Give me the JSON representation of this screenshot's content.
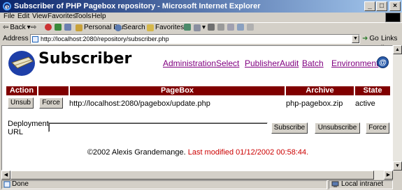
{
  "window": {
    "title": "Subscriber of PHP Pagebox repository - Microsoft Internet Explorer",
    "buttons": {
      "minimize": "_",
      "maximize": "□",
      "close": "×"
    }
  },
  "menu": [
    "File",
    "Edit",
    "View",
    "Favorites",
    "Tools",
    "Help"
  ],
  "toolbar": {
    "back": "Back",
    "personal_bar": "Personal Bar",
    "search": "Search",
    "favorites": "Favorites"
  },
  "address": {
    "label": "Address",
    "url": "http://localhost:2080/repository/subscriber.php",
    "go": "Go",
    "links": "Links"
  },
  "page": {
    "title": "Subscriber",
    "nav": [
      "Administration",
      "Select",
      "Publisher",
      "Audit",
      "Batch",
      "Environment"
    ],
    "help_glyph": "@",
    "table": {
      "headers": {
        "action": "Action",
        "pagebox": "PageBox",
        "archive": "Archive",
        "state": "State"
      },
      "row": {
        "unsub": "Unsub",
        "force": "Force",
        "pagebox": "http://localhost:2080/pagebox/update.php",
        "archive": "php-pagebox.zip",
        "state": "active"
      }
    },
    "deployment": {
      "label": "Deployment URL",
      "value": "",
      "subscribe": "Subscribe",
      "unsubscribe": "Unsubscribe",
      "force": "Force"
    },
    "footer": {
      "copyright": "©2002 Alexis Grandemange.",
      "modified": "Last modified 01/12/2002 00:58:44."
    }
  },
  "status": {
    "text": "Done",
    "zone": "Local intranet"
  },
  "colors": {
    "header_bg": "#800000",
    "visited_link": "#800080",
    "modified_text": "#cc0000"
  }
}
